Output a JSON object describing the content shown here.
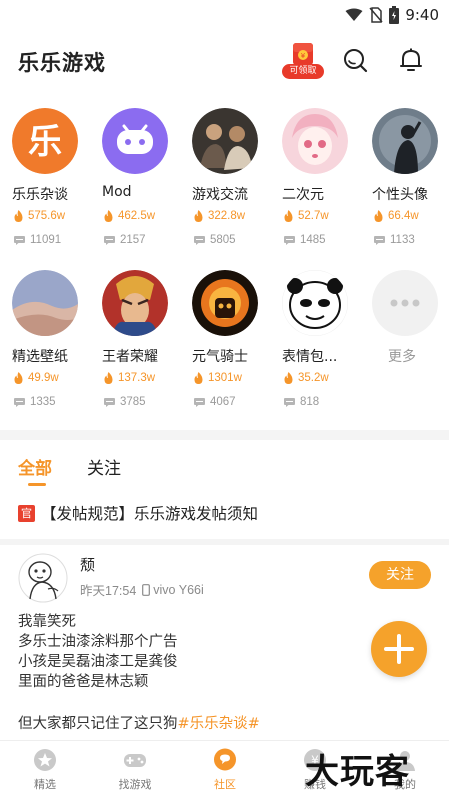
{
  "status_bar": {
    "time": "9:40"
  },
  "header": {
    "title": "乐乐游戏",
    "gift_tag": "可领取"
  },
  "categories": [
    {
      "name": "乐乐杂谈",
      "heat": "575.6w",
      "posts": "11091"
    },
    {
      "name": "Mod",
      "heat": "462.5w",
      "posts": "2157"
    },
    {
      "name": "游戏交流",
      "heat": "322.8w",
      "posts": "5805"
    },
    {
      "name": "二次元",
      "heat": "52.7w",
      "posts": "1485"
    },
    {
      "name": "个性头像",
      "heat": "66.4w",
      "posts": "1133"
    },
    {
      "name": "精选壁纸",
      "heat": "49.9w",
      "posts": "1335"
    },
    {
      "name": "王者荣耀",
      "heat": "137.3w",
      "posts": "3785"
    },
    {
      "name": "元气骑士",
      "heat": "1301w",
      "posts": "4067"
    },
    {
      "name": "表情包...",
      "heat": "35.2w",
      "posts": "818"
    }
  ],
  "more": {
    "label": "更多"
  },
  "tabs": [
    {
      "label": "全部",
      "active": true
    },
    {
      "label": "关注",
      "active": false
    }
  ],
  "notice": {
    "badge": "官",
    "text": "【发帖规范】乐乐游戏发帖须知"
  },
  "post": {
    "user": "颓",
    "time": "昨天17:54",
    "device": "vivo Y66i",
    "follow_label": "关注",
    "lines": [
      "我靠笑死",
      "多乐士油漆涂料那个广告",
      "小孩是吴磊油漆工是龚俊",
      "里面的爸爸是林志颖"
    ],
    "tail_text": "但大家都只记住了这只狗",
    "hashtag": "#乐乐杂谈#"
  },
  "bottom_nav": [
    {
      "label": "精选",
      "icon": "star-icon"
    },
    {
      "label": "找游戏",
      "icon": "gamepad-icon"
    },
    {
      "label": "社区",
      "icon": "community-icon",
      "active": true
    },
    {
      "label": "赚钱",
      "icon": "coin-icon"
    },
    {
      "label": "我的",
      "icon": "profile-icon"
    }
  ],
  "watermark": "大玩客",
  "colors": {
    "accent": "#f5952a",
    "follow": "#f5a22b",
    "official": "#e8412e"
  }
}
